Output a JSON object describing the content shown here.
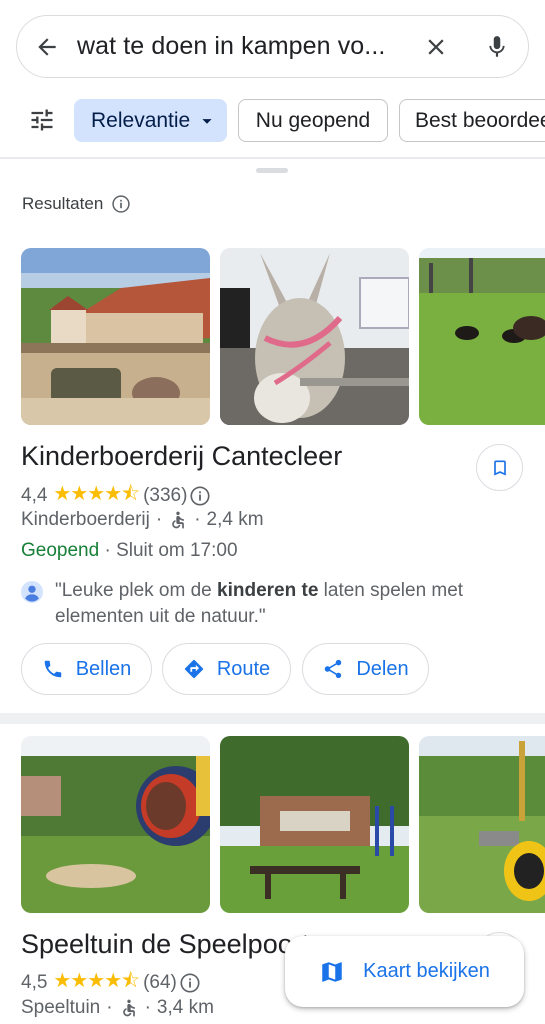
{
  "search": {
    "query": "wat te doen in kampen vo..."
  },
  "filters": {
    "chips": [
      "Relevantie",
      "Nu geopend",
      "Best beoordee"
    ]
  },
  "results_header": "Resultaten",
  "results": [
    {
      "title": "Kinderboerderij Cantecleer",
      "rating": "4,4",
      "rating_value": 4.4,
      "stars": "★★★★⯪",
      "reviews": "(336)",
      "category": "Kinderboerderij",
      "sep1": "·",
      "sep2": "·",
      "distance": "2,4 km",
      "status": "Geopend",
      "hours": "· Sluit om 17:00",
      "review_q1": "\"Leuke plek om de ",
      "review_bold": "kinderen te",
      "review_q2": " laten spelen met elementen uit de natuur.\"",
      "actions": {
        "call": "Bellen",
        "route": "Route",
        "share": "Delen"
      }
    },
    {
      "title": "Speeltuin de Speelpoort",
      "rating": "4,5",
      "rating_value": 4.5,
      "stars": "★★★★⯪",
      "reviews": "(64)",
      "category": "Speeltuin",
      "sep1": "·",
      "sep2": "·",
      "distance": "3,4 km"
    }
  ],
  "map_button": "Kaart bekijken",
  "colors": {
    "accent": "#1a73e8",
    "open": "#188038",
    "star": "#fbbc04",
    "chip_active": "#d3e3fd"
  }
}
